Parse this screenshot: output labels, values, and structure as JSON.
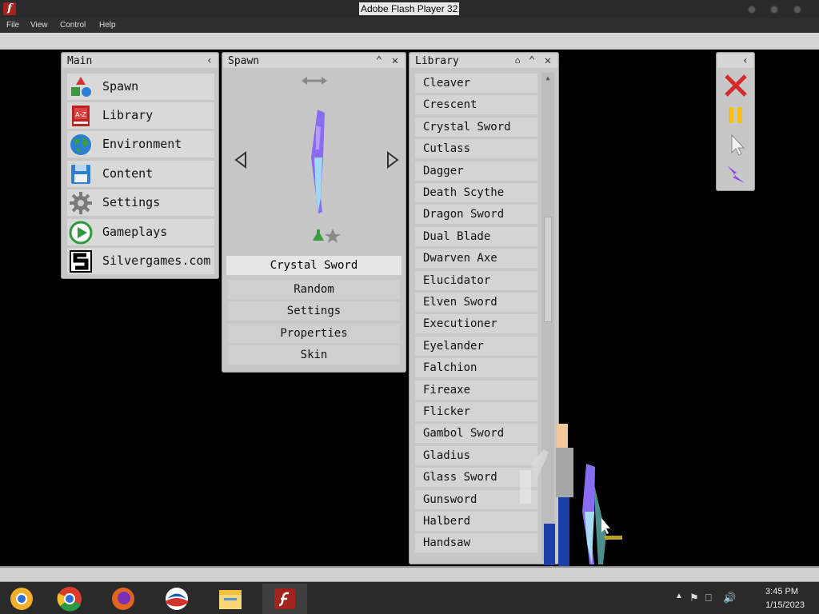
{
  "window": {
    "title": "Adobe Flash Player 32",
    "menu": [
      "File",
      "View",
      "Control",
      "Help"
    ]
  },
  "main_panel": {
    "title": "Main",
    "items": [
      {
        "label": "Spawn",
        "icon": "spawn-shapes-icon"
      },
      {
        "label": "Library",
        "icon": "library-book-icon"
      },
      {
        "label": "Environment",
        "icon": "globe-icon"
      },
      {
        "label": "Content",
        "icon": "floppy-disk-icon"
      },
      {
        "label": "Settings",
        "icon": "gear-icon"
      },
      {
        "label": "Gameplays",
        "icon": "play-icon"
      },
      {
        "label": "Silvergames.com",
        "icon": "silvergames-logo-icon"
      }
    ]
  },
  "spawn_panel": {
    "title": "Spawn",
    "selected": "Crystal Sword",
    "options": [
      "Random",
      "Settings",
      "Properties",
      "Skin"
    ]
  },
  "library_panel": {
    "title": "Library",
    "items": [
      "Cleaver",
      "Crescent",
      "Crystal Sword",
      "Cutlass",
      "Dagger",
      "Death Scythe",
      "Dragon Sword",
      "Dual Blade",
      "Dwarven Axe",
      "Elucidator",
      "Elven Sword",
      "Executioner",
      "Eyelander",
      "Falchion",
      "Fireaxe",
      "Flicker",
      "Gambol Sword",
      "Gladius",
      "Glass Sword",
      "Gunsword",
      "Halberd",
      "Handsaw"
    ]
  },
  "tools_panel": {
    "tools": [
      "close-x-icon",
      "pause-icon",
      "cursor-icon",
      "lightning-icon"
    ]
  },
  "taskbar": {
    "time": "3:45 PM",
    "date": "1/15/2023"
  },
  "colors": {
    "panel_bg": "#c7c7c7",
    "crystal_blade": "#8a6cf0",
    "flash_red": "#a3231f"
  }
}
